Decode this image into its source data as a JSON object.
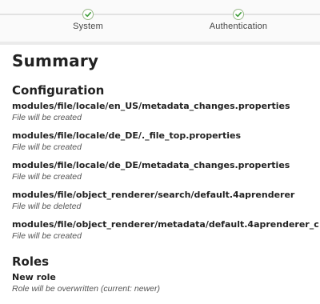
{
  "steps": [
    {
      "label": "System",
      "icon": "check-icon",
      "state": "done"
    },
    {
      "label": "Authentication",
      "icon": "check-icon",
      "state": "done"
    }
  ],
  "summary": {
    "title": "Summary"
  },
  "configuration": {
    "title": "Configuration",
    "items": [
      {
        "name": "modules/file/locale/en_US/metadata_changes.properties",
        "status": "File will be created"
      },
      {
        "name": "modules/file/locale/de_DE/._file_top.properties",
        "status": "File will be created"
      },
      {
        "name": "modules/file/locale/de_DE/metadata_changes.properties",
        "status": "File will be created"
      },
      {
        "name": "modules/file/object_renderer/search/default.4aprenderer",
        "status": "File will be deleted"
      },
      {
        "name": "modules/file/object_renderer/metadata/default.4aprenderer_c",
        "status": "File will be created"
      }
    ]
  },
  "roles": {
    "title": "Roles",
    "items": [
      {
        "name": "New role",
        "status": "Role will be overwritten (current: newer)"
      }
    ]
  },
  "colors": {
    "check": "#3f9e3a",
    "line": "#e2e2e2"
  }
}
